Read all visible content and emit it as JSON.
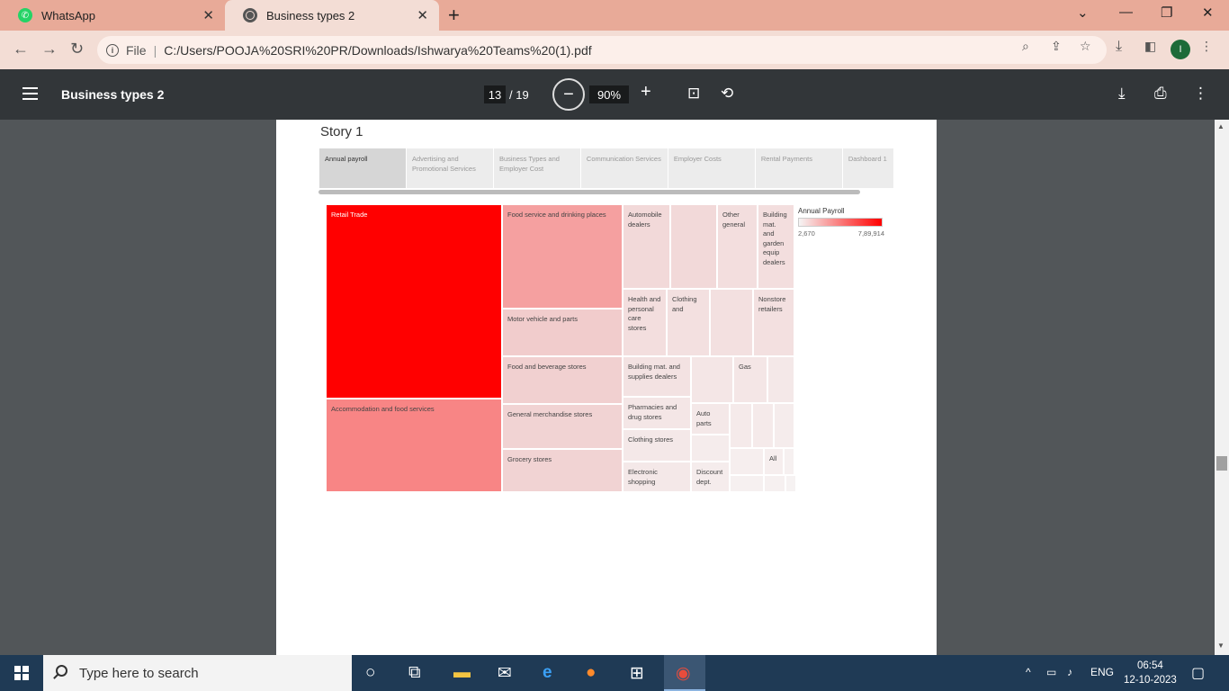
{
  "browser": {
    "tabs": [
      {
        "title": "WhatsApp",
        "icon": "whatsapp-icon"
      },
      {
        "title": "Business types 2",
        "icon": "globe-icon"
      }
    ],
    "new_tab": "+",
    "address": {
      "scheme_label": "File",
      "separator": "|",
      "url": "C:/Users/POOJA%20SRI%20PR/Downloads/Ishwarya%20Teams%20(1).pdf"
    },
    "profile_initial": "I"
  },
  "pdf_toolbar": {
    "title": "Business types 2",
    "current_page": "13",
    "total_pages": "/ 19",
    "zoom": "90%"
  },
  "document": {
    "story_title": "Story 1",
    "story_tabs": [
      "Annual payroll",
      "Advertising and Promotional Services",
      "Business Types and Employer Cost",
      "Communication Services",
      "Employer Costs",
      "Rental Payments",
      "Dashboard 1"
    ]
  },
  "chart_data": {
    "type": "heatmap",
    "title": "",
    "legend": {
      "title": "Annual Payroll",
      "min_label": "2,670",
      "max_label": "7,89,914",
      "color_low": "#f5f5f5",
      "color_high": "#ff0000"
    },
    "cells": [
      {
        "label": "Retail Trade"
      },
      {
        "label": "Accommodation and food services"
      },
      {
        "label": "Food service and drinking places"
      },
      {
        "label": "Motor vehicle and parts"
      },
      {
        "label": "Food and beverage stores"
      },
      {
        "label": "General merchandise stores"
      },
      {
        "label": "Grocery stores"
      },
      {
        "label": "Automobile dealers"
      },
      {
        "label": "Other general"
      },
      {
        "label": "Building mat. and garden equip dealers"
      },
      {
        "label": "Health and personal care stores"
      },
      {
        "label": "Clothing and"
      },
      {
        "label": "Nonstore retailers"
      },
      {
        "label": "Building mat. and supplies dealers"
      },
      {
        "label": "Gas"
      },
      {
        "label": "Pharmacies and drug stores"
      },
      {
        "label": "Auto parts"
      },
      {
        "label": "Clothing stores"
      },
      {
        "label": "Electronic shopping"
      },
      {
        "label": "Discount dept."
      },
      {
        "label": "All"
      }
    ]
  },
  "taskbar": {
    "search_placeholder": "Type here to search",
    "language": "ENG",
    "time": "06:54",
    "date": "12-10-2023"
  }
}
